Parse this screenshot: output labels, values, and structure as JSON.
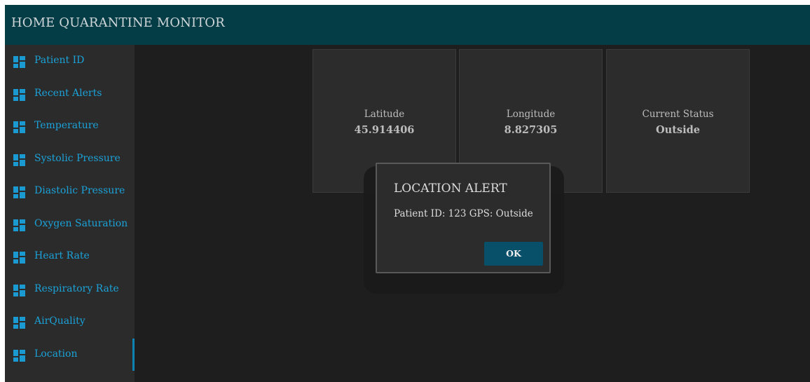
{
  "header": {
    "title": "HOME QUARANTINE MONITOR"
  },
  "sidebar": {
    "items": [
      {
        "label": "Patient ID",
        "icon": "dashboard-icon",
        "active": false
      },
      {
        "label": "Recent Alerts",
        "icon": "dashboard-icon",
        "active": false
      },
      {
        "label": "Temperature",
        "icon": "dashboard-icon",
        "active": false
      },
      {
        "label": "Systolic Pressure",
        "icon": "dashboard-icon",
        "active": false
      },
      {
        "label": "Diastolic Pressure",
        "icon": "dashboard-icon",
        "active": false
      },
      {
        "label": "Oxygen Saturation",
        "icon": "dashboard-icon",
        "active": false
      },
      {
        "label": "Heart Rate",
        "icon": "dashboard-icon",
        "active": false
      },
      {
        "label": "Respiratory Rate",
        "icon": "dashboard-icon",
        "active": false
      },
      {
        "label": "AirQuality",
        "icon": "dashboard-icon",
        "active": false
      },
      {
        "label": "Location",
        "icon": "dashboard-icon",
        "active": true
      }
    ]
  },
  "cards": [
    {
      "label": "Latitude",
      "value": "45.914406"
    },
    {
      "label": "Longitude",
      "value": "8.827305"
    },
    {
      "label": "Current Status",
      "value": "Outside"
    }
  ],
  "dialog": {
    "title": "LOCATION ALERT",
    "message": "Patient ID: 123 GPS: Outside",
    "ok_label": "OK"
  },
  "colors": {
    "header_bg": "#053d47",
    "sidebar_bg": "#2b2b2b",
    "main_bg": "#1e1e1e",
    "accent": "#1ba2d8",
    "button_bg": "#08506a"
  }
}
